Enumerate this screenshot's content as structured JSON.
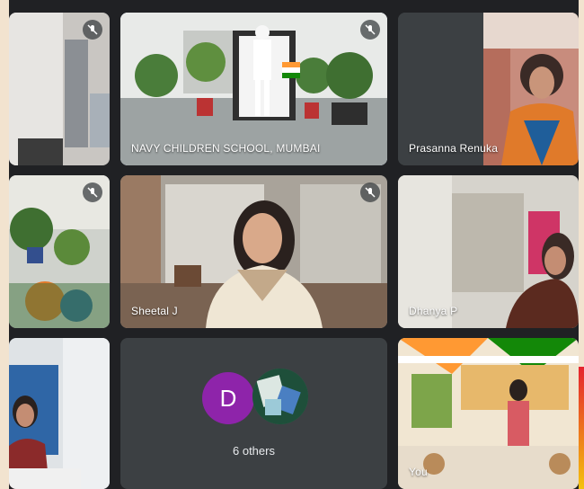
{
  "meeting": {
    "tiles": [
      {
        "id": "t1",
        "label": "",
        "muted": true
      },
      {
        "id": "t2",
        "label": "NAVY CHILDREN SCHOOL, MUMBAI",
        "muted": true,
        "active": true
      },
      {
        "id": "t3",
        "label": "Prasanna Renuka",
        "muted": false
      },
      {
        "id": "t4",
        "label": "",
        "muted": true
      },
      {
        "id": "t5",
        "label": "Sheetal J",
        "muted": true
      },
      {
        "id": "t6",
        "label": "Dhanya P",
        "muted": false
      },
      {
        "id": "t7",
        "label": "",
        "muted": false
      },
      {
        "id": "t8",
        "label": "6 others",
        "avatar_letter": "D",
        "muted": false
      },
      {
        "id": "t9",
        "label": "You",
        "muted": false
      }
    ]
  },
  "colors": {
    "background": "#202124",
    "tile": "#3c4043",
    "active_border": "#8ab4f8",
    "avatar": "#8e24aa"
  }
}
